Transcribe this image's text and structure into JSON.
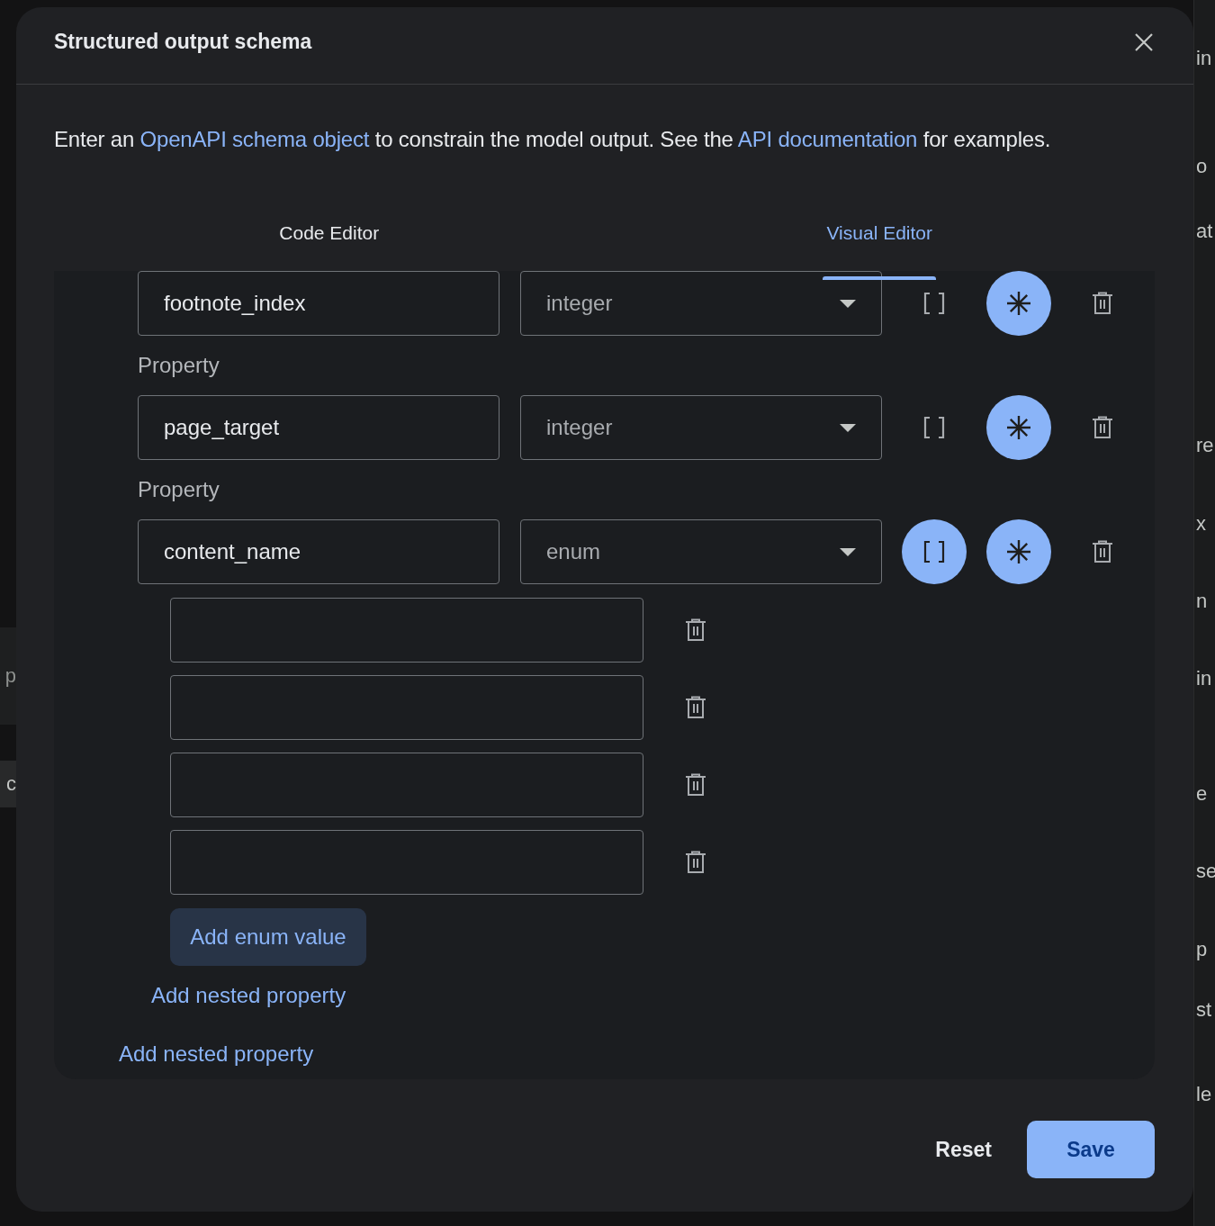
{
  "background": {
    "left_fragments": [
      "p",
      "c"
    ],
    "right_fragments": [
      "in",
      "o",
      "at",
      "re",
      "x",
      "n",
      "in",
      "e",
      "se",
      "p",
      "st",
      "le"
    ]
  },
  "dialog": {
    "title": "Structured output schema",
    "description": [
      {
        "kind": "text",
        "text": "Enter an"
      },
      {
        "kind": "link",
        "text": "OpenAPI schema object"
      },
      {
        "kind": "text",
        "text": "to constrain the model output. See the"
      },
      {
        "kind": "link",
        "text": "API documentation"
      },
      {
        "kind": "text",
        "text": "for examples."
      }
    ],
    "tabs": [
      {
        "label": "Code Editor",
        "selected": false
      },
      {
        "label": "Visual Editor",
        "selected": true
      }
    ],
    "properties": [
      {
        "name": "footnote_index",
        "type": "integer",
        "array": false,
        "required": true
      },
      {
        "label": "Property",
        "name": "page_target",
        "type": "integer",
        "array": false,
        "required": true
      },
      {
        "label": "Property",
        "name": "content_name",
        "type": "enum",
        "array": true,
        "required": true,
        "enum_values": [
          {
            "kind": "empty"
          },
          {
            "kind": "empty"
          },
          {
            "kind": "empty"
          },
          {
            "kind": "empty"
          }
        ],
        "add_enum_button": "Add enum value",
        "add_nested_link": "Add nested property"
      }
    ],
    "add_nested_link": "Add nested property",
    "buttons": [
      {
        "label": "Reset",
        "kind": "text"
      },
      {
        "label": "Save",
        "kind": "filled"
      }
    ]
  }
}
